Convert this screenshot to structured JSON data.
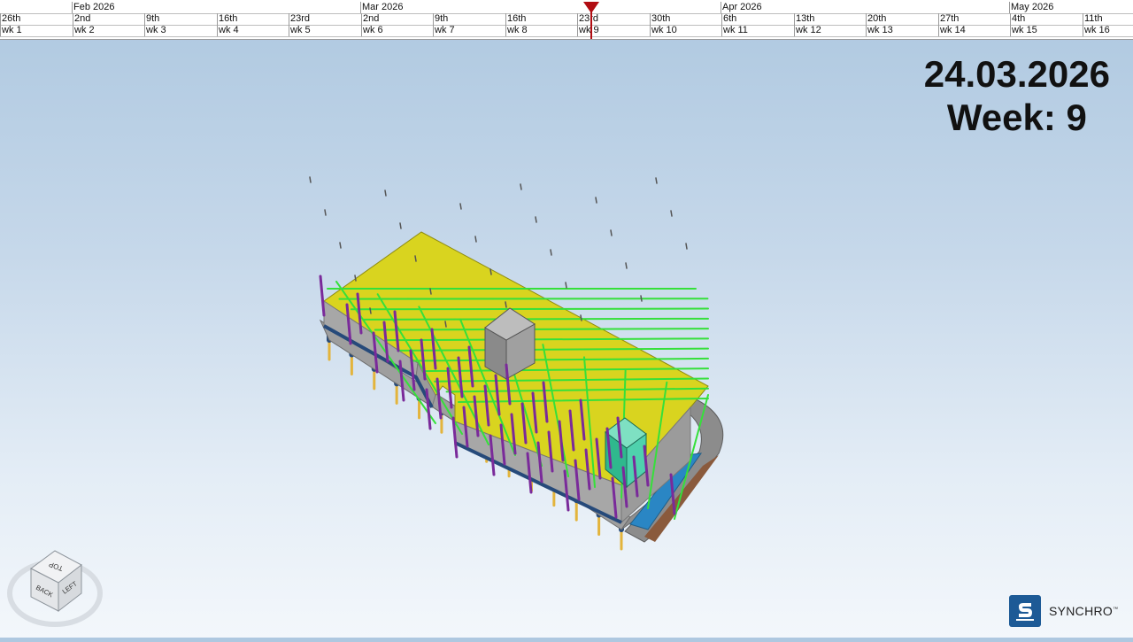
{
  "timeline": {
    "months": [
      {
        "label": "Feb 2026"
      },
      {
        "label": "Mar 2026"
      },
      {
        "label": "Apr 2026"
      },
      {
        "label": "May 2026"
      }
    ],
    "days": [
      "26th",
      "2nd",
      "9th",
      "16th",
      "23rd",
      "2nd",
      "9th",
      "16th",
      "23rd",
      "30th",
      "6th",
      "13th",
      "20th",
      "27th",
      "4th",
      "11th"
    ],
    "weeks": [
      "wk 1",
      "wk 2",
      "wk 3",
      "wk 4",
      "wk 5",
      "wk 6",
      "wk 7",
      "wk 8",
      "wk 9",
      "wk 10",
      "wk 11",
      "wk 12",
      "wk 13",
      "wk 14",
      "wk 15",
      "wk 16"
    ],
    "marker_color": "#b10d12"
  },
  "overlay": {
    "date": "24.03.2026",
    "week": "Week: 9"
  },
  "view_cube": {
    "top": "TOP",
    "back": "BACK",
    "left": "LEFT"
  },
  "brand": {
    "name": "SYNCHRO",
    "tm": "™",
    "color": "#1d5a96"
  },
  "colors": {
    "slab": "#d9d41f",
    "beam": "#35e03a",
    "column": "#7a2a9a",
    "pile": "#e3b43c",
    "concrete": "#a7a7a7",
    "core_teal": "#3ec9a0",
    "ramp_blue": "#2a86c4"
  }
}
